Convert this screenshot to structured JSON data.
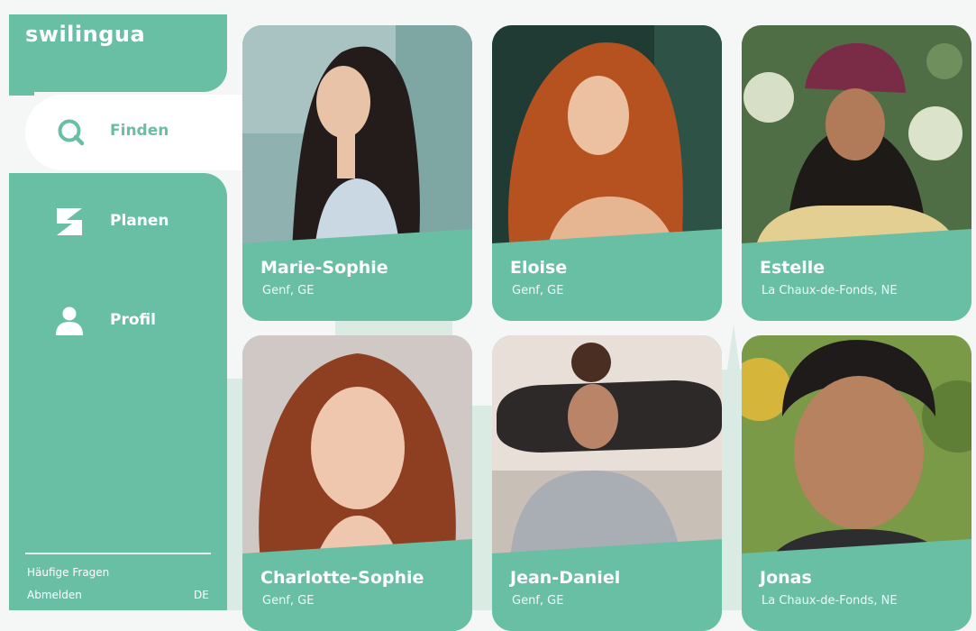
{
  "brand": {
    "logo_text": "swilingua",
    "accent": "#69bfa3"
  },
  "nav": {
    "items": [
      {
        "label": "Finden",
        "icon": "search-icon",
        "active": true
      },
      {
        "label": "Planen",
        "icon": "plan-icon",
        "active": false
      },
      {
        "label": "Profil",
        "icon": "user-icon",
        "active": false
      }
    ]
  },
  "footer": {
    "faq": "Häufige Fragen",
    "logout": "Abmelden",
    "language": "DE"
  },
  "profiles": [
    {
      "name": "Marie-Sophie",
      "place": "Genf, GE"
    },
    {
      "name": "Eloise",
      "place": "Genf, GE"
    },
    {
      "name": "Estelle",
      "place": "La Chaux-de-Fonds, NE"
    },
    {
      "name": "Charlotte-Sophie",
      "place": "Genf, GE"
    },
    {
      "name": "Jean-Daniel",
      "place": "Genf, GE"
    },
    {
      "name": "Jonas",
      "place": "La Chaux-de-Fonds, NE"
    }
  ]
}
